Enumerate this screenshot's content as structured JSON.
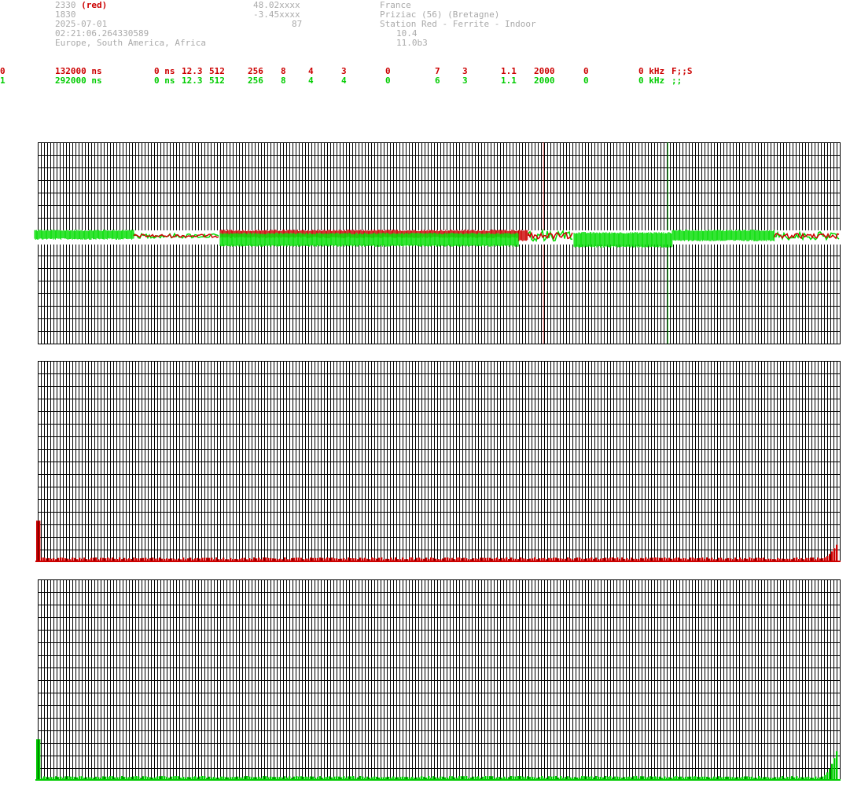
{
  "header": {
    "col1": [
      "2330",
      "1830",
      "2025-07-01",
      "02:21:06.264330589",
      "Europe, South America, Africa"
    ],
    "col1_suffix": "(red)",
    "col2": [
      "48.02xxxx",
      "-3.45xxxx",
      "87"
    ],
    "col3": [
      "France",
      "Priziac (56) (Bretagne)",
      "Station Red - Ferrite - Indoor"
    ],
    "col3b": [
      "10.4",
      "11.0b3"
    ]
  },
  "channels": [
    {
      "id": "0",
      "period": "132000 ns",
      "f1": "0 ns",
      "f2": "12.3",
      "f3": "512",
      "f4": "256",
      "f5": "8",
      "f6": "4",
      "f7": "3",
      "f8": "0",
      "f9": "7",
      "f10": "3",
      "f11": "1.1",
      "f12": "2000",
      "f13": "0",
      "f14": "0 kHz",
      "f15": "F;;S"
    },
    {
      "id": "1",
      "period": "292000 ns",
      "f1": "0 ns",
      "f2": "12.3",
      "f3": "512",
      "f4": "256",
      "f5": "8",
      "f6": "4",
      "f7": "4",
      "f8": "0",
      "f9": "6",
      "f10": "3",
      "f11": "1.1",
      "f12": "2000",
      "f13": "0",
      "f14": "0 kHz",
      "f15": ";;"
    }
  ],
  "colors": {
    "red": "#cc0000",
    "green": "#00dd00",
    "grid": "#000000",
    "header": "#aaaaaa"
  },
  "chart_data": [
    {
      "type": "line",
      "title": "",
      "grid": true,
      "series": [
        {
          "color": "#cc0000",
          "marker_position": 0.63,
          "description": "red waveform band, dense in middle section"
        },
        {
          "color": "#00dd00",
          "marker_position": 0.785,
          "description": "green waveform band"
        }
      ]
    },
    {
      "type": "bar",
      "title": "",
      "grid": true,
      "series": [
        {
          "color": "#cc0000",
          "first_value": 0.2,
          "last_value": 0.08,
          "baseline": 0.01
        }
      ]
    },
    {
      "type": "bar",
      "title": "",
      "grid": true,
      "series": [
        {
          "color": "#00cc00",
          "first_value": 0.2,
          "last_value": 0.14,
          "baseline": 0.01
        }
      ]
    }
  ]
}
